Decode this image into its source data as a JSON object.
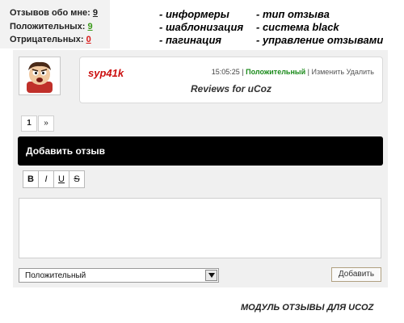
{
  "stats": {
    "about_me_label": "Отзывов обо мне:",
    "about_me_count": "9",
    "positive_label": "Положительных:",
    "positive_count": "9",
    "negative_label": "Отрицательных:",
    "negative_count": "0"
  },
  "features": [
    "- информеры",
    "- шаблонизация",
    "- пагинация",
    "- тип отзыва",
    "- система black",
    "- управление отзывами"
  ],
  "review": {
    "avatar_icon": "cartoon-avatar-icon",
    "nickname": "syp41k",
    "time": "15:05:25",
    "sep1": "|",
    "type": "Положительный",
    "sep2": "|",
    "edit": "Изменить",
    "delete": "Удалить",
    "text": "Reviews for uCoz"
  },
  "pagination": {
    "current": "1",
    "next": "»"
  },
  "add_review": {
    "title": "Добавить отзыв"
  },
  "format_buttons": [
    "B",
    "I",
    "U",
    "S"
  ],
  "form": {
    "textarea_value": "",
    "type_selected": "Положительный",
    "submit_label": "Добавить"
  },
  "footer": "МОДУЛЬ ОТЗЫВЫ ДЛЯ UCOZ",
  "colors": {
    "positive": "#3a9a1a",
    "negative": "#d81818",
    "nickname": "#cc1111",
    "header_bar": "#000000"
  }
}
